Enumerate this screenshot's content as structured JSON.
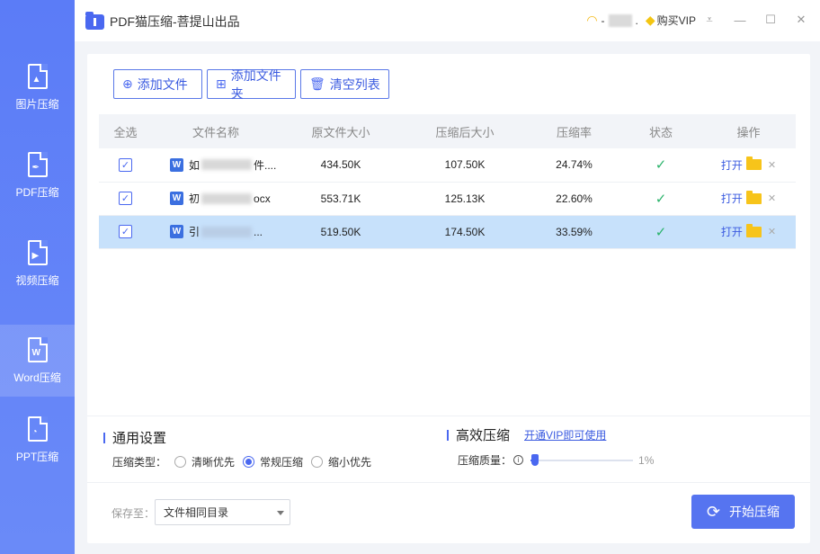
{
  "app": {
    "title": "PDF猫压缩-菩提山出品"
  },
  "user": {
    "name_prefix": "-",
    "name_suffix": ".",
    "buy_vip": "购买VIP"
  },
  "sidebar": {
    "items": [
      {
        "label": "图片压缩",
        "glyph": "▲"
      },
      {
        "label": "PDF压缩",
        "glyph": "✒"
      },
      {
        "label": "视频压缩",
        "glyph": "▶"
      },
      {
        "label": "Word压缩",
        "glyph": "W"
      },
      {
        "label": "PPT压缩",
        "glyph": "◔"
      }
    ]
  },
  "toolbar": {
    "add_file": "添加文件",
    "add_folder": "添加文件夹",
    "clear_list": "清空列表"
  },
  "table": {
    "headers": [
      "全选",
      "文件名称",
      "原文件大小",
      "压缩后大小",
      "压缩率",
      "状态",
      "操作"
    ],
    "rows": [
      {
        "name_start": "如",
        "name_end": "件....",
        "orig": "434.50K",
        "comp": "107.50K",
        "ratio": "24.74%",
        "open": "打开"
      },
      {
        "name_start": "初",
        "name_end": "ocx",
        "orig": "553.71K",
        "comp": "125.13K",
        "ratio": "22.60%",
        "open": "打开"
      },
      {
        "name_start": "引",
        "name_end": "...",
        "orig": "519.50K",
        "comp": "174.50K",
        "ratio": "33.59%",
        "open": "打开"
      }
    ]
  },
  "settings": {
    "general_title": "通用设置",
    "type_label": "压缩类型：",
    "options": [
      "清晰优先",
      "常规压缩",
      "缩小优先"
    ],
    "selected_option": "常规压缩",
    "efficient_title": "高效压缩",
    "vip_link": "开通VIP即可使用",
    "quality_label": "压缩质量：",
    "quality_value": "1%",
    "quality_level": 0.01
  },
  "save": {
    "label": "保存至：",
    "value": "文件相同目录"
  },
  "start_button": "开始压缩",
  "colors": {
    "accent": "#4a68f0",
    "sidebar": "#5b7cf7",
    "selected_row": "#c7e1fb",
    "success": "#2bb36b",
    "folder": "#f7c41a"
  }
}
